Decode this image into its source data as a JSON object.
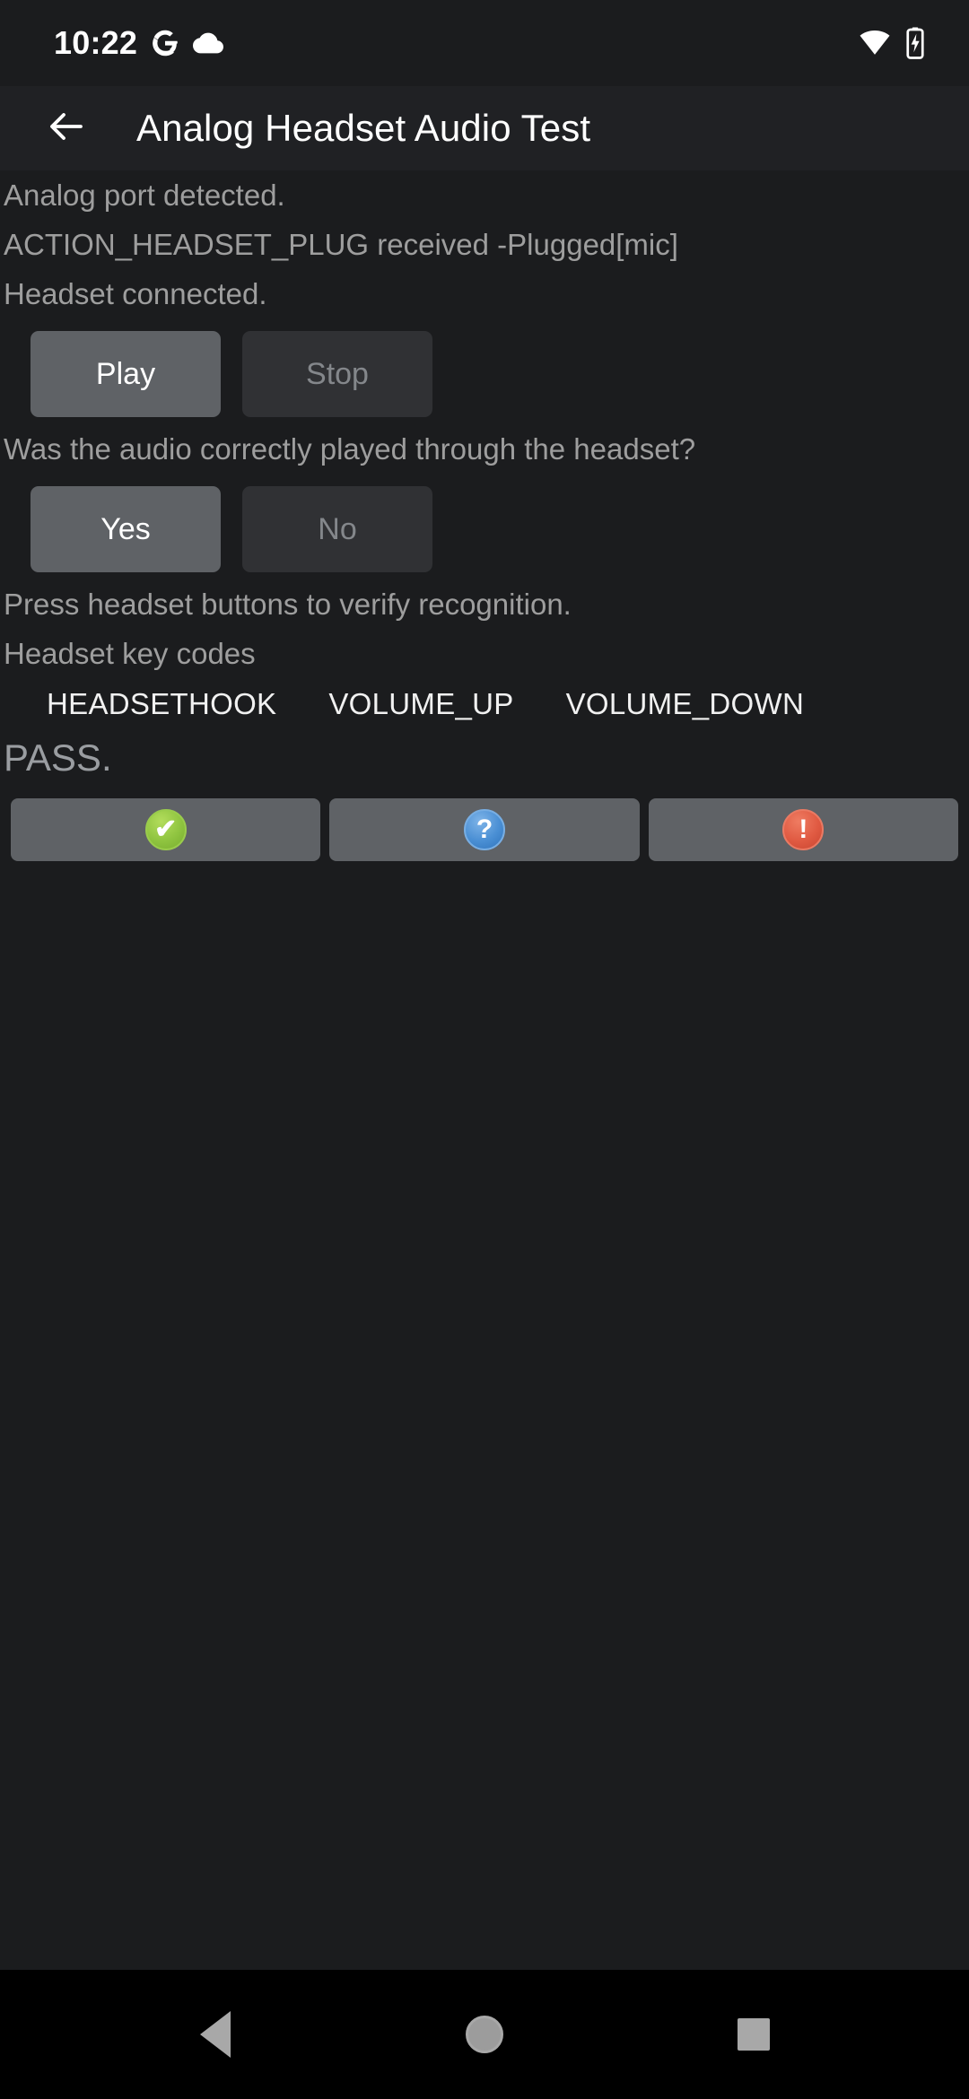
{
  "status_bar": {
    "time": "10:22",
    "icons": [
      "google-g-icon",
      "cloud-icon",
      "wifi-icon",
      "battery-charging-icon"
    ]
  },
  "toolbar": {
    "back_icon": "arrow-back-icon",
    "title": "Analog Headset Audio Test"
  },
  "main": {
    "info_lines": [
      "Analog port detected.",
      "ACTION_HEADSET_PLUG received -Plugged[mic]",
      "Headset connected."
    ],
    "playback_controls": {
      "play_label": "Play",
      "stop_label": "Stop"
    },
    "question": "Was the audio correctly played through the headset?",
    "answer_controls": {
      "yes_label": "Yes",
      "no_label": "No"
    },
    "instruction": "Press headset buttons to verify recognition.",
    "keycodes_label": "Headset key codes",
    "keycodes": [
      "HEADSETHOOK",
      "VOLUME_UP",
      "VOLUME_DOWN"
    ],
    "verdict": "PASS."
  },
  "verdict_bar": {
    "pass_icon": "check-circle-icon",
    "info_icon": "question-circle-icon",
    "fail_icon": "exclamation-circle-icon",
    "pass_glyph": "✔",
    "info_glyph": "?",
    "fail_glyph": "!",
    "pass_color": "#8fc440",
    "info_color": "#4a8fd4",
    "fail_color": "#e05a42"
  },
  "nav_bar": {
    "back": "nav-back-icon",
    "home": "nav-home-icon",
    "recents": "nav-recents-icon"
  }
}
